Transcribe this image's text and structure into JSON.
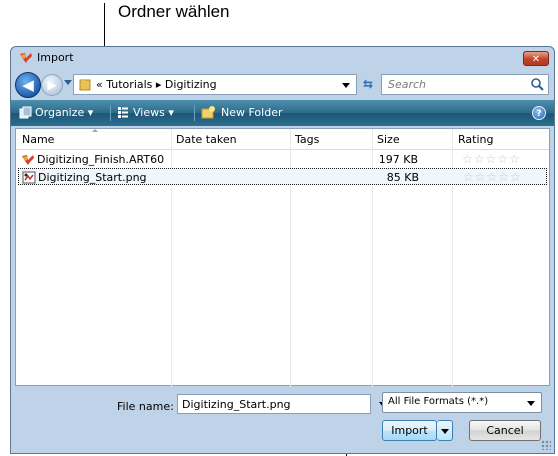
{
  "callouts": {
    "top_label": "Ordner wählen"
  },
  "window": {
    "title": "Import",
    "close_glyph": "✕"
  },
  "navigation": {
    "back_glyph": "◀",
    "forward_glyph": "▶",
    "breadcrumbs": "« Tutorials ▸ Digitizing",
    "refresh_glyph": "⇆",
    "search_placeholder": "Search"
  },
  "toolbar": {
    "organize": "Organize",
    "views": "Views",
    "new_folder": "New Folder",
    "help": "?"
  },
  "columns": {
    "name": "Name",
    "date_taken": "Date taken",
    "tags": "Tags",
    "size": "Size",
    "rating": "Rating"
  },
  "files": [
    {
      "name": "Digitizing_Finish.ART60",
      "size": "197 KB",
      "rating": "☆☆☆☆☆",
      "icon": "art60-file-icon"
    },
    {
      "name": "Digitizing_Start.png",
      "size": "85 KB",
      "rating": "☆☆☆☆☆",
      "icon": "png-file-icon",
      "selected": true
    }
  ],
  "bottom": {
    "file_name_label": "File name:",
    "file_name_value": "Digitizing_Start.png",
    "filter_value": "All File Formats (*.*)",
    "import_label": "Import",
    "cancel_label": "Cancel"
  },
  "colors": {
    "toolbar": "#2d6a8a",
    "close": "#c0442a",
    "selection": "#f1f6fb"
  }
}
